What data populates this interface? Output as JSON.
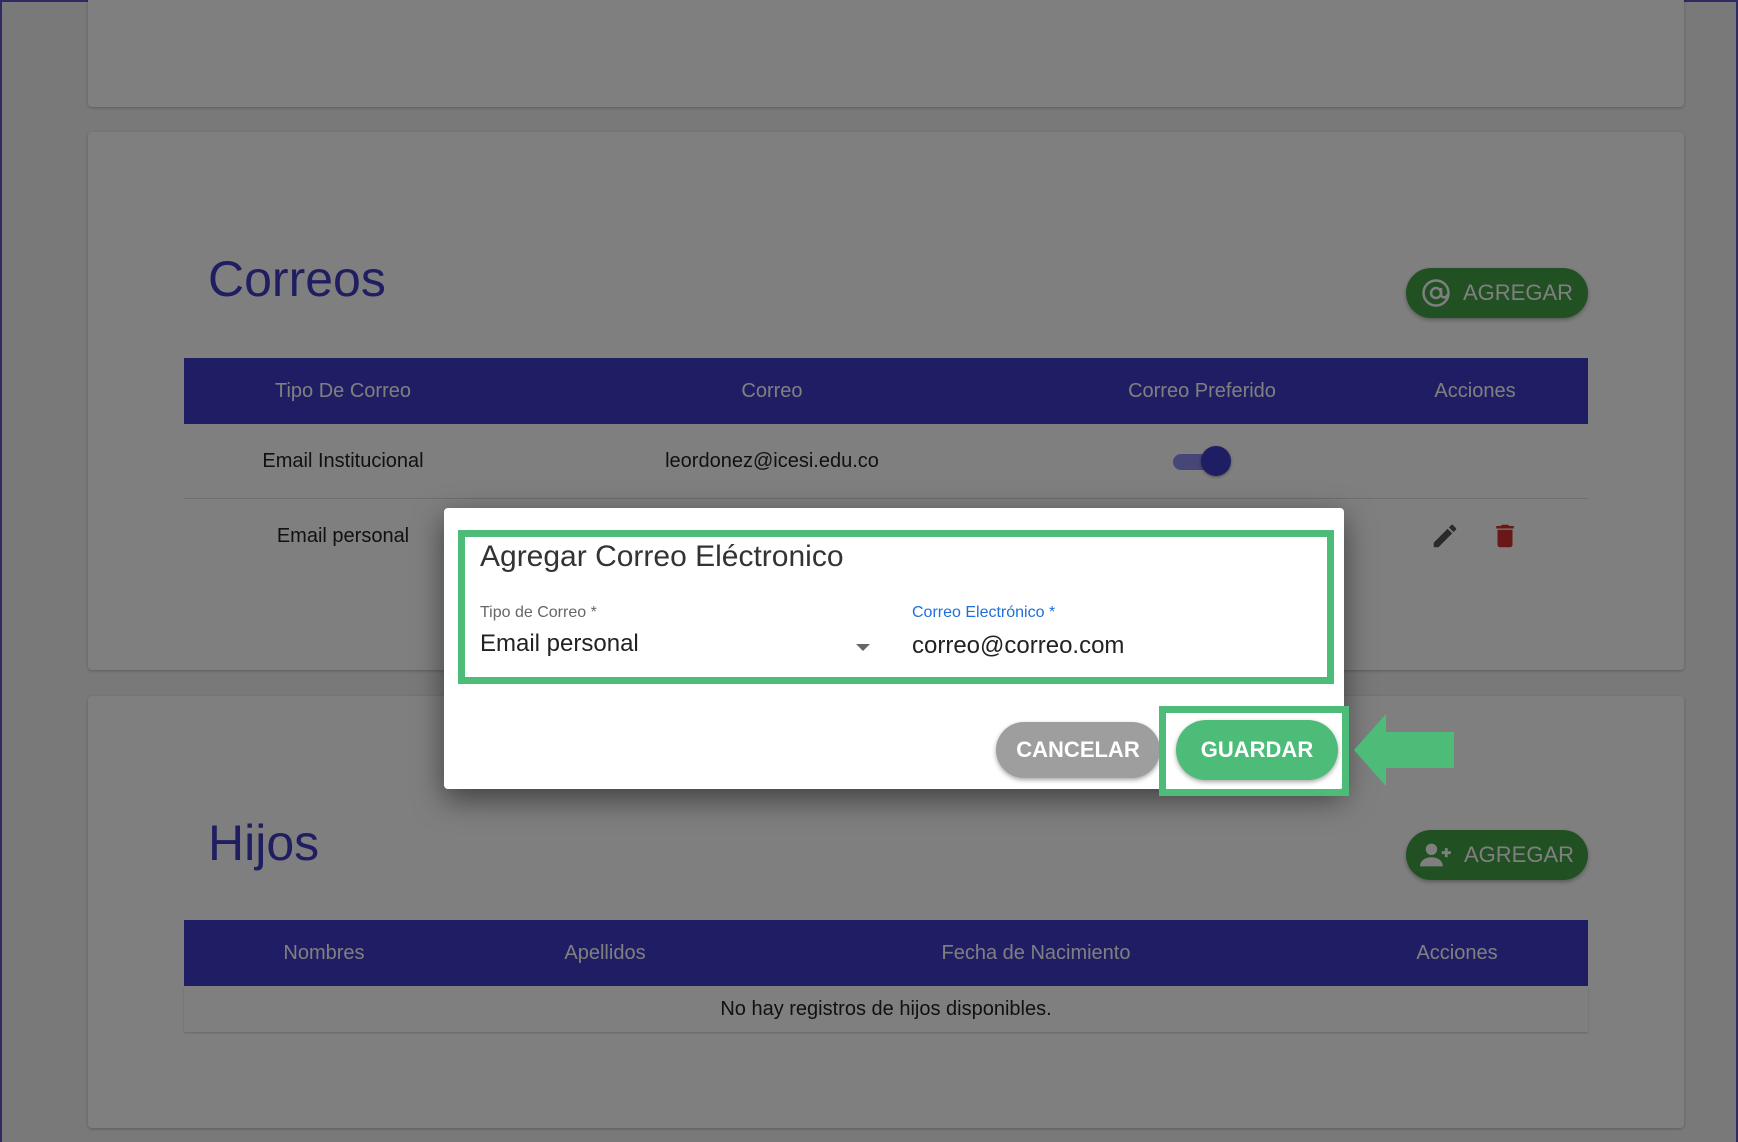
{
  "correos": {
    "title": "Correos",
    "add_label": "AGREGAR",
    "add_icon": "at-icon",
    "columns": [
      "Tipo De Correo",
      "Correo",
      "Correo Preferido",
      "Acciones"
    ],
    "rows": [
      {
        "tipo": "Email Institucional",
        "correo": "leordonez@icesi.edu.co",
        "preferido": true
      },
      {
        "tipo": "Email personal",
        "correo": "",
        "preferido": false
      }
    ]
  },
  "hijos": {
    "title": "Hijos",
    "add_label": "AGREGAR",
    "add_icon": "person-add-icon",
    "columns": [
      "Nombres",
      "Apellidos",
      "Fecha de Nacimiento",
      "Acciones"
    ],
    "empty_message": "No hay registros de hijos disponibles."
  },
  "dialog": {
    "title": "Agregar Correo Eléctronico",
    "tipo_label": "Tipo de Correo *",
    "tipo_value": "Email personal",
    "correo_label": "Correo Electrónico *",
    "correo_value": "correo@correo.com",
    "cancel_label": "CANCELAR",
    "save_label": "GUARDAR"
  },
  "colors": {
    "primary": "#3f3cc9",
    "success": "#43a047",
    "highlight": "#4cbc78",
    "delete": "#d32f2f",
    "cancel": "#9e9e9e"
  }
}
